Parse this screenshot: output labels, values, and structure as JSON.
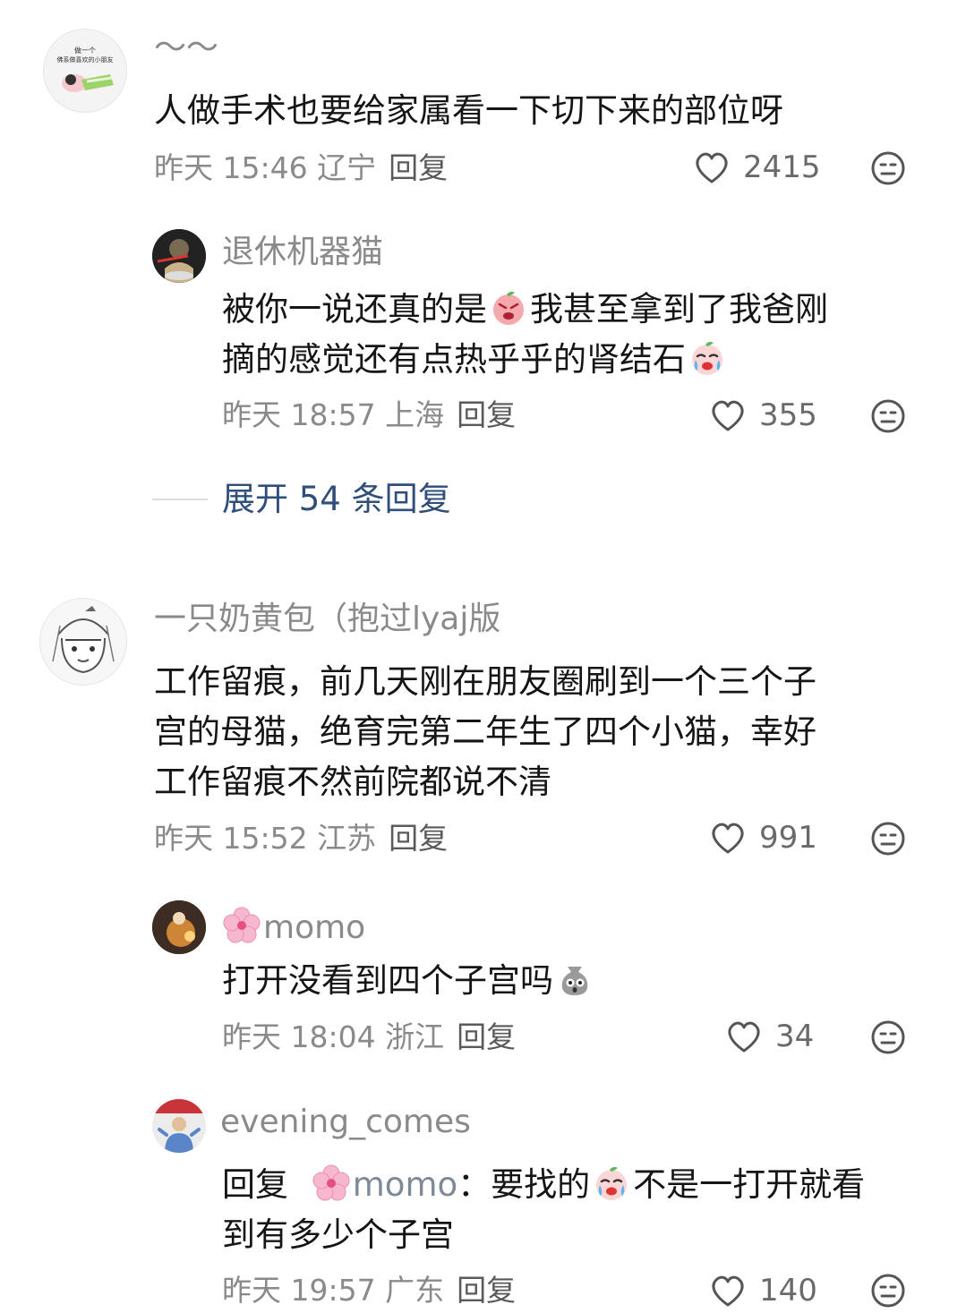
{
  "comments": [
    {
      "name": "～～",
      "avatar_text": "做一个 佛系做喜欢的小朋友",
      "text": "人做手术也要给家属看一下切下来的部位呀",
      "meta": "昨天 15:46 辽宁",
      "reply_label": "回复",
      "likes": "2415",
      "reply": {
        "name": "退休机器猫",
        "text_part1": "被你一说还真的是",
        "text_part2": "我甚至拿到了我爸刚",
        "text_part3": "摘的感觉还有点热乎乎的肾结石",
        "meta": "昨天 18:57 上海",
        "reply_label": "回复",
        "likes": "355"
      },
      "expand_label": "展开 54 条回复"
    },
    {
      "name": "一只奶黄包（抱过lyaj版",
      "text_line1": "工作留痕，前几天刚在朋友圈刷到一个三个子",
      "text_line2": "宫的母猫，绝育完第二年生了四个小猫，幸好",
      "text_line3": "工作留痕不然前院都说不清",
      "meta": "昨天 15:52 江苏",
      "reply_label": "回复",
      "likes": "991",
      "replies": [
        {
          "name": "momo",
          "text": "打开没看到四个子宫吗",
          "meta": "昨天 18:04 浙江",
          "reply_label": "回复",
          "likes": "34"
        },
        {
          "name": "evening_comes",
          "reply_prefix": "回复",
          "reply_to": "momo",
          "text_part1": "：要找的",
          "text_part2": "不是一打开就看",
          "text_line2": "到有多少个子宫",
          "meta": "昨天 19:57 广东",
          "reply_label": "回复",
          "likes": "140"
        }
      ]
    }
  ],
  "icons": {
    "like": "heart-outline-icon",
    "meh": "meh-face-icon",
    "flower": "cherry-blossom-emoji"
  },
  "colors": {
    "text": "#151515",
    "meta": "#8a8a8a",
    "link": "#2f4e7a",
    "background": "#ffffff"
  }
}
